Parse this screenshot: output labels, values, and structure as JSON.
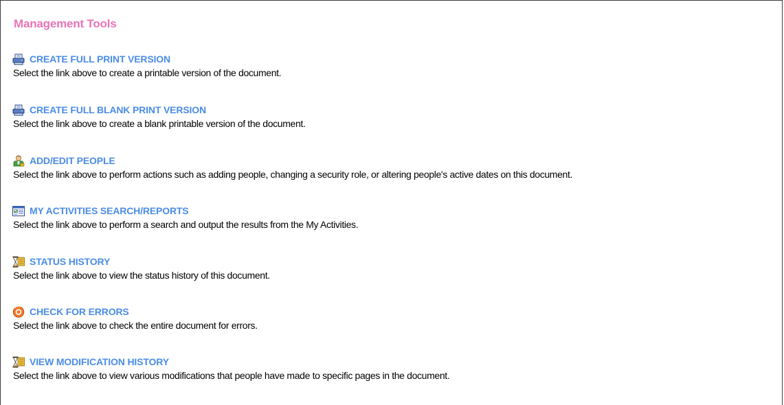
{
  "panel": {
    "title": "Management Tools"
  },
  "tools": [
    {
      "label": "CREATE FULL PRINT VERSION",
      "description": "Select the link above to create a printable version of the document.",
      "icon": "printer-icon"
    },
    {
      "label": "CREATE FULL BLANK PRINT VERSION",
      "description": "Select the link above to create a blank printable version of the document.",
      "icon": "printer-icon"
    },
    {
      "label": "ADD/EDIT PEOPLE",
      "description": "Select the link above to perform actions such as adding people, changing a security role, or altering people's active dates on this document.",
      "icon": "person-icon"
    },
    {
      "label": "MY ACTIVITIES SEARCH/REPORTS",
      "description": "Select the link above to perform a search and output the results from the My Activities.",
      "icon": "activity-report-icon"
    },
    {
      "label": "STATUS HISTORY",
      "description": "Select the link above to view the status history of this document.",
      "icon": "hourglass-history-icon"
    },
    {
      "label": "CHECK FOR ERRORS",
      "description": "Select the link above to check the entire document for errors.",
      "icon": "error-check-icon"
    },
    {
      "label": "VIEW MODIFICATION HISTORY",
      "description": "Select the link above to view various modifications that people have made to specific pages in the document.",
      "icon": "hourglass-history-icon"
    }
  ],
  "colors": {
    "title": "#e874b6",
    "link": "#4a8ce6",
    "text": "#000000",
    "border": "#3a3a3a"
  }
}
